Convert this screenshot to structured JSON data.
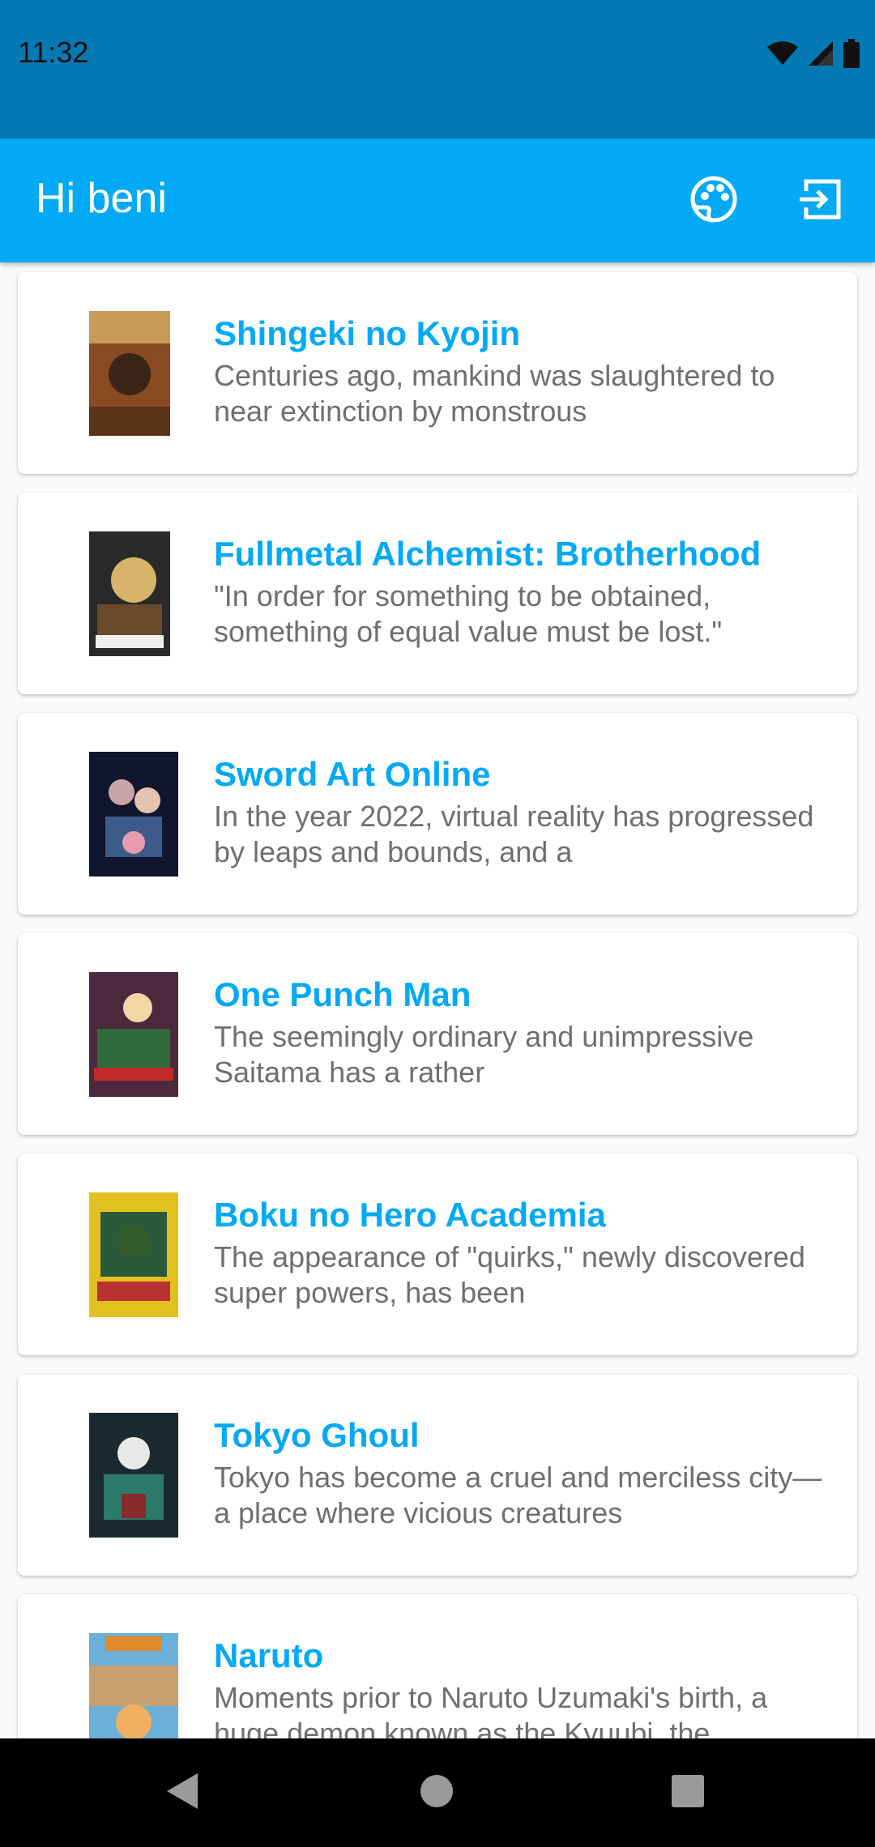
{
  "status_bar": {
    "time": "11:32",
    "icons": [
      "wifi-icon",
      "signal-icon",
      "battery-icon"
    ]
  },
  "app_bar": {
    "title": "Hi beni",
    "actions": [
      "palette-icon",
      "logout-icon"
    ]
  },
  "colors": {
    "status_bar": "#0379b4",
    "app_bar": "#03a9f4",
    "title_text": "#03a9f4",
    "desc_text": "#6f6f6f"
  },
  "anime_list": [
    {
      "title": "Shingeki no Kyojin",
      "description": "Centuries ago, mankind was slaughtered to near extinction by monstrous",
      "poster_colors": [
        "#8a4a22",
        "#c79a55",
        "#3a2516"
      ]
    },
    {
      "title": "Fullmetal Alchemist: Brotherhood",
      "description": "\"In order for something to be obtained, something of equal value must be lost.\"",
      "poster_colors": [
        "#2a2a2a",
        "#d8b36a",
        "#6a4a2a"
      ]
    },
    {
      "title": "Sword Art Online",
      "description": "In the year 2022, virtual reality has progressed by leaps and bounds, and a",
      "poster_colors": [
        "#12152e",
        "#c9a6a6",
        "#3c5b8a"
      ]
    },
    {
      "title": "One Punch Man",
      "description": "The seemingly ordinary and unimpressive Saitama has a rather",
      "poster_colors": [
        "#4c2a3e",
        "#2f6b3a",
        "#c32b2b"
      ]
    },
    {
      "title": "Boku no Hero Academia",
      "description": "The appearance of \"quirks,\" newly discovered super powers, has been",
      "poster_colors": [
        "#e2c020",
        "#2b5a3a",
        "#b83232"
      ]
    },
    {
      "title": "Tokyo Ghoul",
      "description": "Tokyo has become a cruel and merciless city—a place where vicious creatures",
      "poster_colors": [
        "#1a2a2e",
        "#2e7a6a",
        "#8a2a2a"
      ]
    },
    {
      "title": "Naruto",
      "description": "Moments prior to Naruto Uzumaki's birth, a huge demon known as the Kyuubi, the",
      "poster_colors": [
        "#e08a2a",
        "#6ab0d8",
        "#c8a070"
      ]
    }
  ],
  "nav_bar": {
    "buttons": [
      "back-icon",
      "home-icon",
      "recents-icon"
    ]
  }
}
